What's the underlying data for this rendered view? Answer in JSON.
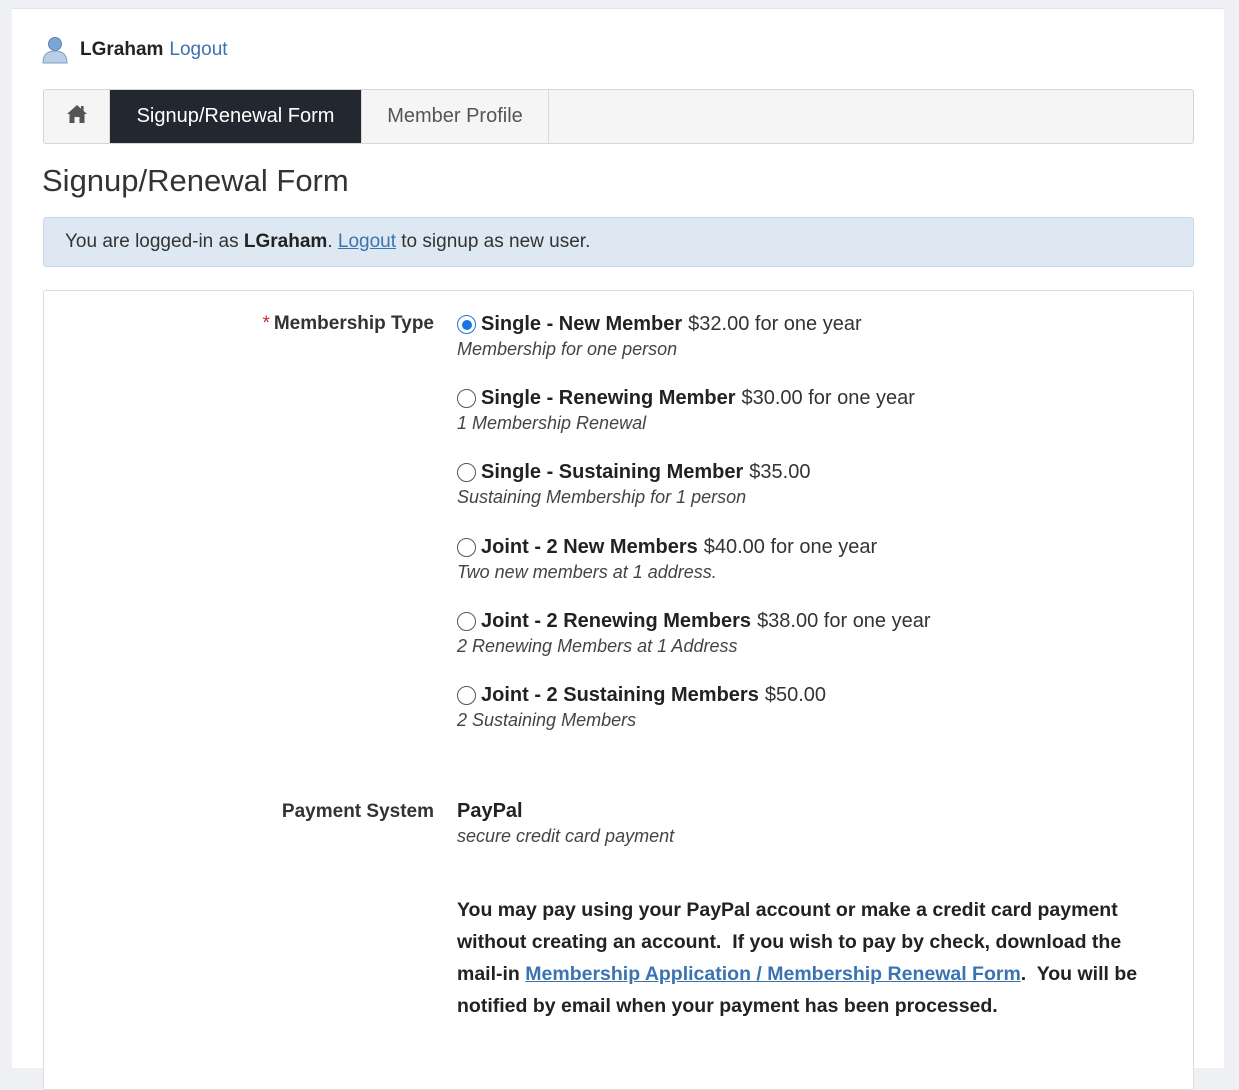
{
  "user": {
    "name": "LGraham",
    "logout_label": "Logout"
  },
  "nav": {
    "home_icon": "home-icon",
    "tabs": [
      {
        "label": "Signup/Renewal Form",
        "active": true
      },
      {
        "label": "Member Profile",
        "active": false
      }
    ]
  },
  "page": {
    "title": "Signup/Renewal Form"
  },
  "alert": {
    "prefix": "You are logged-in as ",
    "username": "LGraham",
    "separator": ". ",
    "link": "Logout",
    "suffix": " to signup as new user."
  },
  "form": {
    "membership_label": "Membership Type",
    "required_mark": "*",
    "membership_options": [
      {
        "name": "Single - New Member",
        "price": "$32.00 for one year",
        "desc": "Membership for one person",
        "selected": true
      },
      {
        "name": "Single - Renewing Member",
        "price": "$30.00 for one year",
        "desc": "1 Membership Renewal",
        "selected": false
      },
      {
        "name": "Single - Sustaining Member",
        "price": "$35.00",
        "desc": "Sustaining Membership for 1 person",
        "selected": false
      },
      {
        "name": "Joint - 2 New Members",
        "price": "$40.00 for one year",
        "desc": "Two new members at 1 address.",
        "selected": false
      },
      {
        "name": "Joint - 2 Renewing Members",
        "price": "$38.00 for one year",
        "desc": "2 Renewing Members at 1 Address",
        "selected": false
      },
      {
        "name": "Joint - 2 Sustaining Members",
        "price": "$50.00",
        "desc": "2 Sustaining Members",
        "selected": false
      }
    ],
    "payment_label": "Payment System",
    "payment_name": "PayPal",
    "payment_desc": "secure credit card payment",
    "payment_note": {
      "text_before": "You may pay using your PayPal account or make a credit card payment without creating an account.  If you wish to pay by check, download the mail-in ",
      "link": "Membership Application / Membership Renewal Form",
      "text_after": ".  You will be notified by email when your payment has been processed."
    }
  },
  "colors": {
    "accent": "#3b73b0",
    "nav_active_bg": "#23272f",
    "alert_bg": "#dde8f2",
    "radio_selected": "#1a73e8",
    "required": "#c9302c"
  }
}
